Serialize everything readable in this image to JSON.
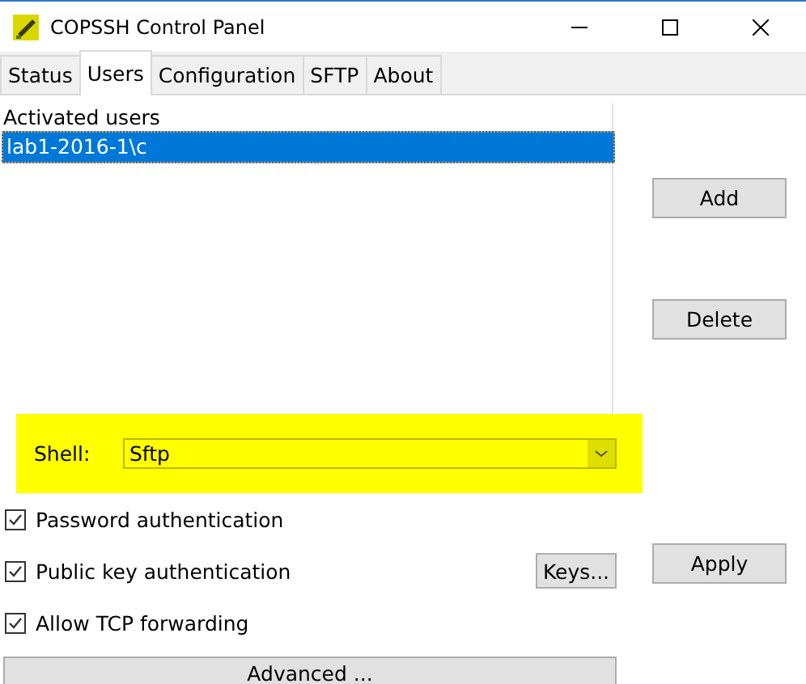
{
  "window": {
    "title": "COPSSH Control Panel"
  },
  "tabs": [
    {
      "label": "Status",
      "selected": false
    },
    {
      "label": "Users",
      "selected": true
    },
    {
      "label": "Configuration",
      "selected": false
    },
    {
      "label": "SFTP",
      "selected": false
    },
    {
      "label": "About",
      "selected": false
    }
  ],
  "users_list": {
    "header": "Activated users",
    "rows": [
      {
        "label": "lab1-2016-1\\c",
        "selected": true
      }
    ]
  },
  "side_buttons": [
    "Add",
    "Delete"
  ],
  "shell": {
    "label": "Shell:",
    "value": "Sftp"
  },
  "options": [
    {
      "label": "Password authentication",
      "checked": true
    },
    {
      "label": "Public key authentication",
      "checked": true
    },
    {
      "label": "Allow TCP forwarding",
      "checked": true
    }
  ],
  "keys_button": "Keys...",
  "apply_button": "Apply",
  "advanced_button": "Advanced ..."
}
